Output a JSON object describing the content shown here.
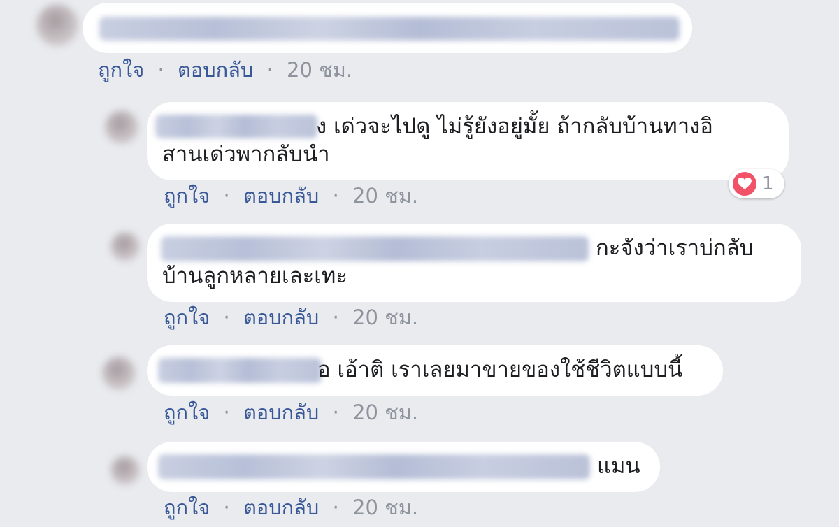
{
  "comments": [
    {
      "text": "",
      "actions": {
        "like": "ถูกใจ",
        "sep": "·",
        "reply": "ตอบกลับ",
        "time": "20 ชม."
      }
    },
    {
      "text_line1": "ง เด่วจะไปดู ไม่รู้ยังอยู่มั้ย ถ้ากลับบ้านทางอิ",
      "text_line2": "สานเด่วพากลับนำ",
      "reaction": {
        "icon": "heart-icon",
        "color": "#f25268",
        "count": "1"
      },
      "actions": {
        "like": "ถูกใจ",
        "sep": "·",
        "reply": "ตอบกลับ",
        "time": "20 ชม."
      }
    },
    {
      "text_line1": "กะจังว่าเราบ่กลับ",
      "text_line2": "บ้านลูกหลายเละเทะ",
      "actions": {
        "like": "ถูกใจ",
        "sep": "·",
        "reply": "ตอบกลับ",
        "time": "20 ชม."
      }
    },
    {
      "text_line1": "อ เอ้าติ เราเลยมาขายของใช้ชีวิตแบบนี้",
      "actions": {
        "like": "ถูกใจ",
        "sep": "·",
        "reply": "ตอบกลับ",
        "time": "20 ชม."
      }
    },
    {
      "text_line1": "แมน",
      "actions": {
        "like": "ถูกใจ",
        "sep": "·",
        "reply": "ตอบกลับ",
        "time": "20 ชม."
      }
    }
  ]
}
